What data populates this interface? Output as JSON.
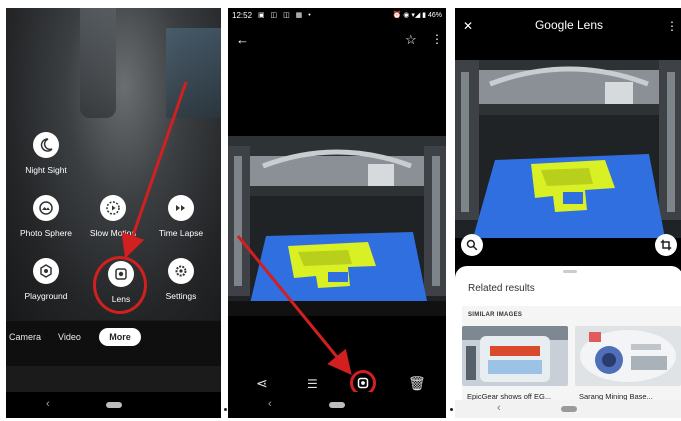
{
  "camera": {
    "modes": [
      {
        "label": "Night Sight",
        "icon": "moon-icon"
      },
      {
        "label": "Photo Sphere",
        "icon": "photo-sphere-icon"
      },
      {
        "label": "Slow Motion",
        "icon": "slow-motion-icon"
      },
      {
        "label": "Time Lapse",
        "icon": "time-lapse-icon"
      },
      {
        "label": "Playground",
        "icon": "playground-icon"
      },
      {
        "label": "Lens",
        "icon": "lens-icon"
      },
      {
        "label": "Settings",
        "icon": "gear-icon"
      }
    ],
    "modebar": {
      "camera": "Camera",
      "video": "Video",
      "more": "More"
    }
  },
  "viewer": {
    "status": {
      "time": "12:52",
      "battery": "46%"
    },
    "actions": [
      "share-icon",
      "edit-icon",
      "lens-icon",
      "delete-icon"
    ]
  },
  "lens": {
    "title": "Google Lens",
    "related_title": "Related results",
    "similar_title": "SIMILAR IMAGES",
    "results": [
      {
        "caption": "EpicGear shows off EG..."
      },
      {
        "caption": "Sarang Mining Base..."
      }
    ]
  },
  "colors": {
    "highlight": "#d21f1f",
    "print_bed": "#2f6fe0",
    "print_object": "#d8f024"
  }
}
